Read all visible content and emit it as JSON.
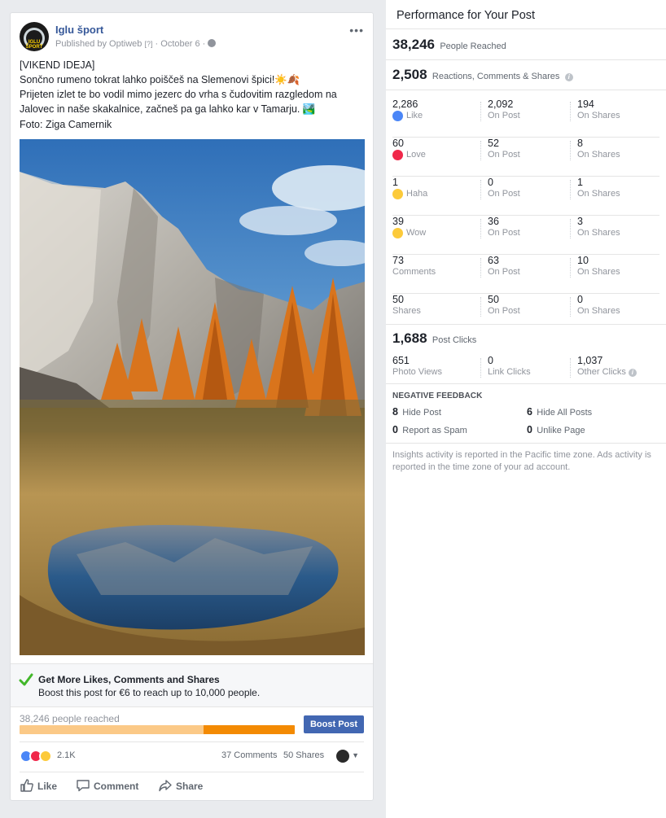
{
  "post": {
    "page_name": "Iglu šport",
    "avatar_text": "IGLU ŠPORT",
    "publisher": "Published by Optiweb",
    "help_mark": "[?]",
    "date": "October 6",
    "more_icon": "more-dots-icon",
    "text_lines": [
      "[VIKEND IDEJA]",
      "Sončno rumeno tokrat lahko poiščeš na Slemenovi špici!☀️🍂",
      "Prijeten izlet te bo vodil mimo jezerc do vrha s čudovitim razgledom na",
      "Jalovec in naše skakalnice, začneš pa ga lahko kar v Tamarju. 🏞️"
    ],
    "photo_credit": "Foto: Ziga Camernik",
    "boost": {
      "title": "Get More Likes, Comments and Shares",
      "subtitle": "Boost this post for €6 to reach up to 10,000 people.",
      "reach_label": "38,246 people reached",
      "reach_fill_fraction": 0.33,
      "button": "Boost Post"
    },
    "reactions_count": "2.1K",
    "comments_count": "37 Comments",
    "shares_count": "50 Shares",
    "actions": {
      "like": "Like",
      "comment": "Comment",
      "share": "Share"
    }
  },
  "insights": {
    "title": "Performance for Your Post",
    "reached": {
      "value": "38,246",
      "label": "People Reached"
    },
    "engagement": {
      "value": "2,508",
      "label": "Reactions, Comments & Shares"
    },
    "rows": [
      {
        "total": "2,286",
        "name": "Like",
        "icon": "like-icon",
        "on_post": "2,092",
        "on_post_label": "On Post",
        "on_shares": "194",
        "on_shares_label": "On Shares"
      },
      {
        "total": "60",
        "name": "Love",
        "icon": "love-icon",
        "on_post": "52",
        "on_post_label": "On Post",
        "on_shares": "8",
        "on_shares_label": "On Shares"
      },
      {
        "total": "1",
        "name": "Haha",
        "icon": "haha-icon",
        "on_post": "0",
        "on_post_label": "On Post",
        "on_shares": "1",
        "on_shares_label": "On Shares"
      },
      {
        "total": "39",
        "name": "Wow",
        "icon": "wow-icon",
        "on_post": "36",
        "on_post_label": "On Post",
        "on_shares": "3",
        "on_shares_label": "On Shares"
      },
      {
        "total": "73",
        "name": "Comments",
        "on_post": "63",
        "on_post_label": "On Post",
        "on_shares": "10",
        "on_shares_label": "On Shares"
      },
      {
        "total": "50",
        "name": "Shares",
        "on_post": "50",
        "on_post_label": "On Post",
        "on_shares": "0",
        "on_shares_label": "On Shares"
      }
    ],
    "clicks": {
      "value": "1,688",
      "label": "Post Clicks",
      "photo_views": "651",
      "photo_views_label": "Photo Views",
      "link_clicks": "0",
      "link_clicks_label": "Link Clicks",
      "other_clicks": "1,037",
      "other_clicks_label": "Other Clicks"
    },
    "negative": {
      "title": "NEGATIVE FEEDBACK",
      "hide_post": "8",
      "hide_post_label": "Hide Post",
      "hide_all": "6",
      "hide_all_label": "Hide All Posts",
      "spam": "0",
      "spam_label": "Report as Spam",
      "unlike": "0",
      "unlike_label": "Unlike Page"
    },
    "footnote": "Insights activity is reported in the Pacific time zone. Ads activity is reported in the time zone of your ad account."
  }
}
